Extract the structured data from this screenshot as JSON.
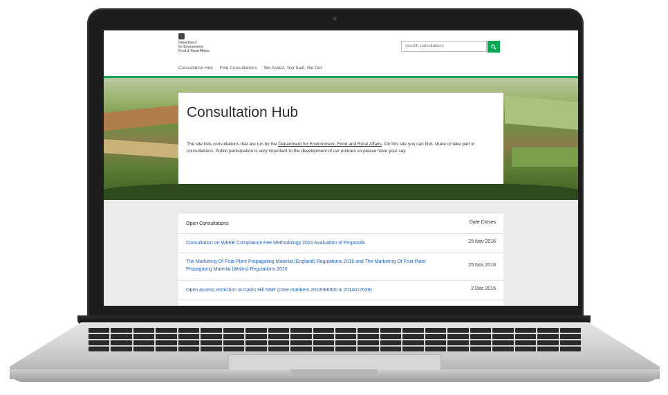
{
  "header": {
    "logo_lines": [
      "Department",
      "for Environment",
      "Food & Rural Affairs"
    ],
    "search_placeholder": "Search consultations",
    "nav": [
      "Consultation Hub",
      "Find Consultations",
      "We Asked, You Said, We Did"
    ]
  },
  "hero": {
    "title": "Consultation Hub",
    "intro_before": "The site lists consultations that are run by the ",
    "intro_link": "Department for Environment, Food and Rural Affairs",
    "intro_after": ". On this site you can find, share or take part in consultations. Public participation is very important to the development of our policies so please have your say."
  },
  "table": {
    "header_title": "Open Consultations",
    "header_date": "Date Closes",
    "rows": [
      {
        "title": "Consultation on WEEE Compliance Fee Methodology 2016 Evaluation of Proposals",
        "date": "25 Nov 2016"
      },
      {
        "title": "The Marketing Of Fruit Plant Propagating Material (England) Regulations 2016 and The Marketing Of Fruit Plant Propagating Material (Wales) Regulations 2016",
        "date": "25 Nov 2016"
      },
      {
        "title": "Open access restriction at Cabin Hill NNR (case numbers 2013086900 & 2014017039)",
        "date": "2 Dec 2016"
      }
    ]
  },
  "colors": {
    "accent": "#00a650",
    "link": "#1f5fbf"
  },
  "icons": {
    "search": "search-icon",
    "crest": "crest-icon"
  }
}
